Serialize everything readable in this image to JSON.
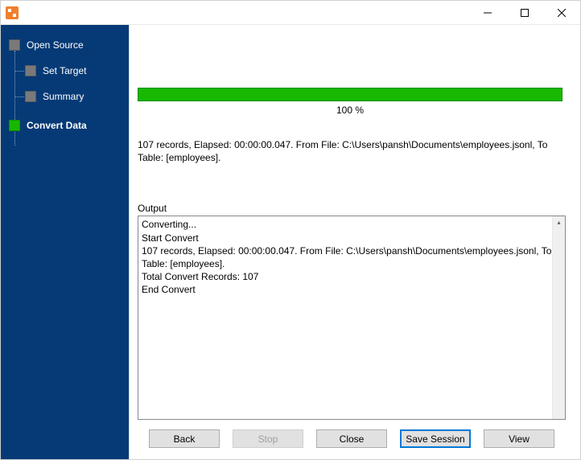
{
  "window": {
    "title": ""
  },
  "sidebar": {
    "items": [
      {
        "label": "Open Source",
        "active": false
      },
      {
        "label": "Set Target",
        "active": false
      },
      {
        "label": "Summary",
        "active": false
      },
      {
        "label": "Convert Data",
        "active": true
      }
    ]
  },
  "progress": {
    "percent_text": "100 %",
    "percent_value": 100
  },
  "status_line": "107 records,    Elapsed: 00:00:00.047.    From File: C:\\Users\\pansh\\Documents\\employees.jsonl,    To Table: [employees].",
  "output": {
    "label": "Output",
    "lines": [
      "Converting...",
      "Start Convert",
      "107 records,    Elapsed: 00:00:00.047.    From File: C:\\Users\\pansh\\Documents\\employees.jsonl,    To Table: [employees].",
      "Total Convert Records: 107",
      "End Convert"
    ]
  },
  "buttons": {
    "back": "Back",
    "stop": "Stop",
    "close": "Close",
    "save_session": "Save Session",
    "view": "View"
  }
}
